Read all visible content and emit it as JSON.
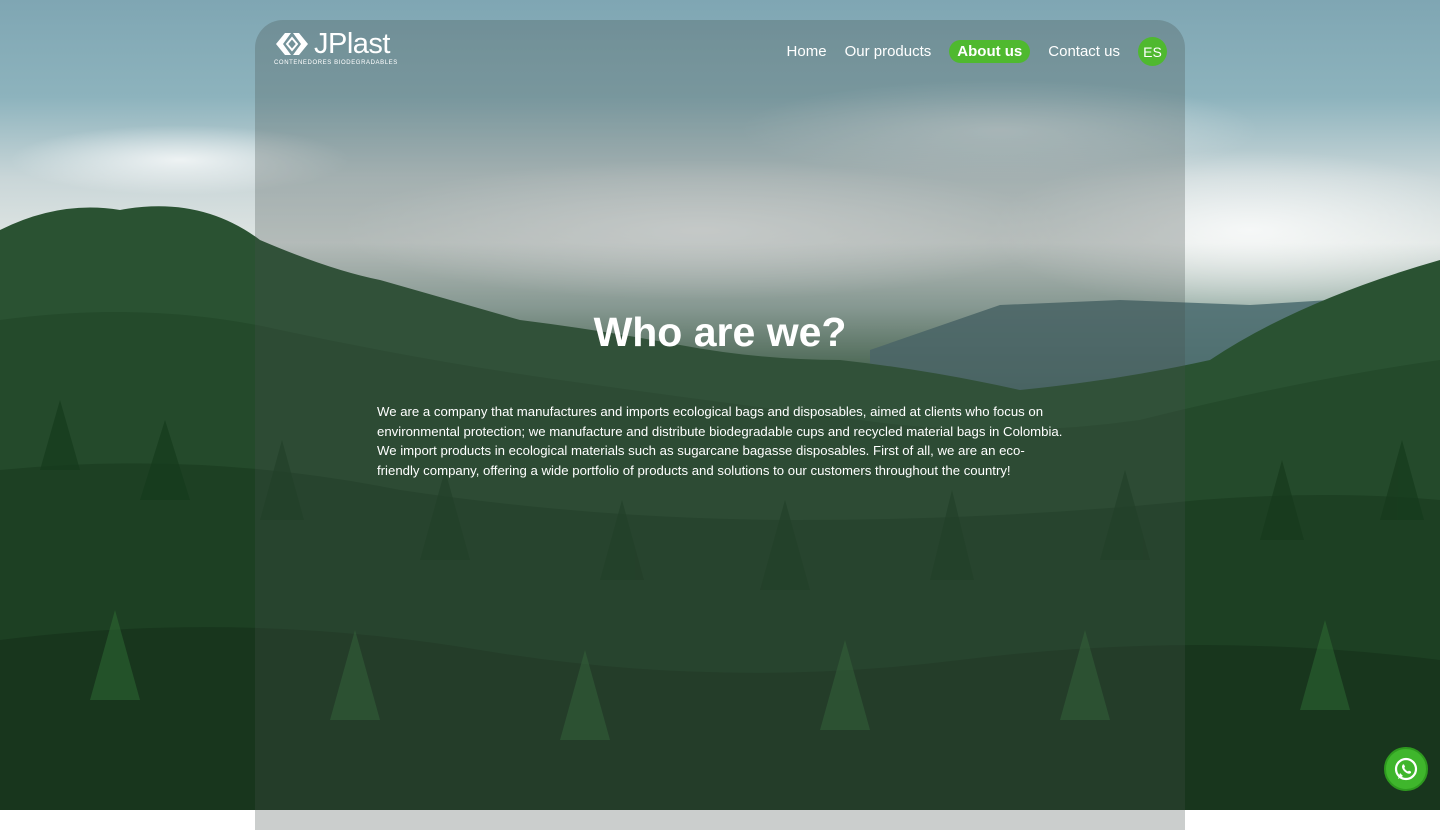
{
  "brand": {
    "name": "JPlast",
    "tagline": "CONTENEDORES BIODEGRADABLES",
    "logo_icon": "recycle-arrows-logo"
  },
  "nav": {
    "items": [
      {
        "label": "Home",
        "active": false
      },
      {
        "label": "Our products",
        "active": false
      },
      {
        "label": "About us",
        "active": true
      },
      {
        "label": "Contact us",
        "active": false
      }
    ],
    "language": "ES"
  },
  "main": {
    "title": "Who are we?",
    "paragraph": "We are a company that manufactures and imports ecological bags and disposables, aimed at clients who focus on environmental protection; we manufacture and distribute biodegradable cups and recycled material bags in Colombia. We import products in ecological materials such as sugarcane bagasse disposables. First of all, we are an eco-friendly company, offering a wide portfolio of products and solutions to our customers throughout the country!"
  },
  "floating": {
    "whatsapp_icon": "whatsapp-icon"
  },
  "colors": {
    "accent": "#4fb92f",
    "whatsapp": "#3fb62c",
    "text": "#ffffff"
  }
}
